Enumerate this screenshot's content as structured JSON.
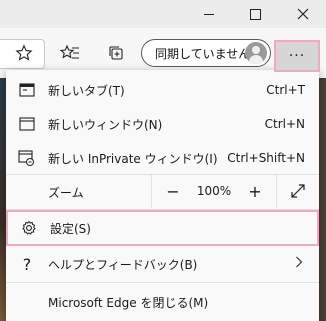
{
  "toolbar": {
    "sync_label": "同期していません",
    "more_label": "···"
  },
  "menu": {
    "new_tab": {
      "label": "新しいタブ(T)",
      "shortcut": "Ctrl+T"
    },
    "new_window": {
      "label": "新しいウィンドウ(N)",
      "shortcut": "Ctrl+N"
    },
    "new_private": {
      "label": "新しい InPrivate ウィンドウ(I)",
      "shortcut": "Ctrl+Shift+N"
    },
    "zoom": {
      "label": "ズーム",
      "minus": "−",
      "value": "100%",
      "plus": "+"
    },
    "settings": {
      "label": "設定(S)"
    },
    "help": {
      "label": "ヘルプとフィードバック(B)"
    },
    "close_edge": {
      "label": "Microsoft Edge を閉じる(M)"
    }
  },
  "colors": {
    "highlight_border": "#f4a7c3",
    "menu_bg": "#f9f9f9"
  }
}
